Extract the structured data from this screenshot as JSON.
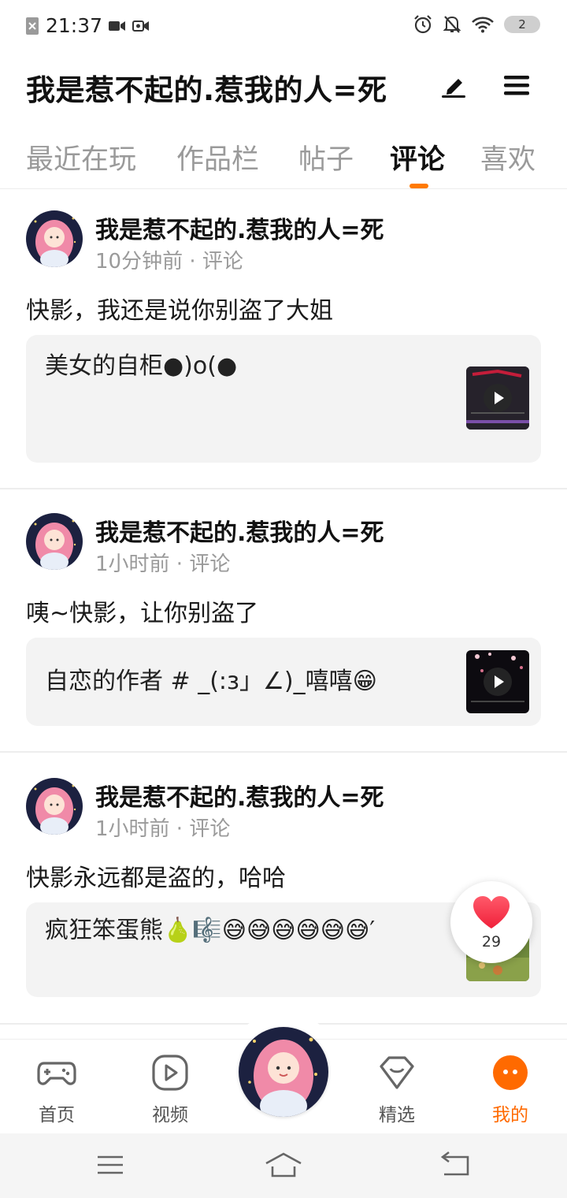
{
  "status_bar": {
    "time": "21:37",
    "battery": "2"
  },
  "header": {
    "title": "我是惹不起的.惹我的人=死"
  },
  "tabs": [
    {
      "label": "最近在玩"
    },
    {
      "label": "作品栏"
    },
    {
      "label": "帖子"
    },
    {
      "label": "评论",
      "active": true
    },
    {
      "label": "喜欢"
    }
  ],
  "posts": [
    {
      "author": "我是惹不起的.惹我的人=死",
      "time": "10分钟前",
      "type": "评论",
      "text": "快影，我还是说你别盗了大姐",
      "quote": "美女的自柜●)o(●"
    },
    {
      "author": "我是惹不起的.惹我的人=死",
      "time": "1小时前",
      "type": "评论",
      "text": "咦~快影，让你别盗了",
      "quote": "自恋的作者 # _(:з」∠)_嘻嘻😁"
    },
    {
      "author": "我是惹不起的.惹我的人=死",
      "time": "1小时前",
      "type": "评论",
      "text": "快影永远都是盗的，哈哈",
      "quote": "疯狂笨蛋熊🍐🎼😅😅😅😅😅😅′"
    }
  ],
  "like_button": {
    "count": "29"
  },
  "bottom_nav": [
    {
      "label": "首页",
      "icon": "gamepad-icon"
    },
    {
      "label": "视频",
      "icon": "play-circle-icon"
    },
    {
      "label": "精选",
      "icon": "heart-diamond-icon"
    },
    {
      "label": "我的",
      "icon": "face-icon",
      "active": true
    }
  ],
  "colors": {
    "accent": "#ff6a00",
    "tab_indicator": "#ff7a00",
    "muted_text": "#9a9a9a",
    "card_bg": "#f3f3f3"
  }
}
